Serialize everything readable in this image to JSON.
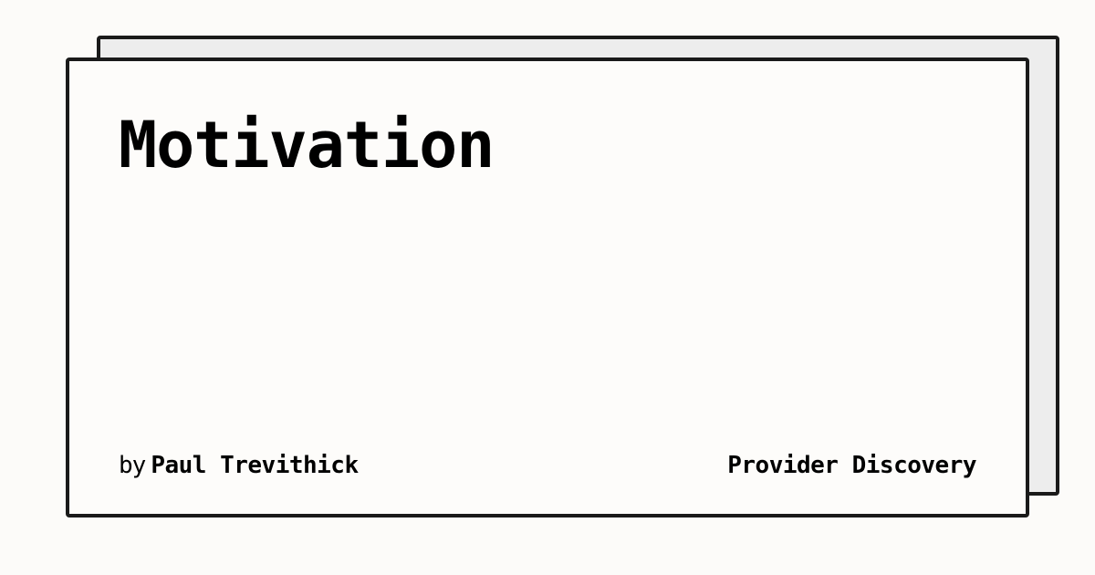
{
  "card": {
    "title": "Motivation",
    "byline_prefix": "by",
    "author": "Paul Trevithick",
    "site_name": "Provider Discovery"
  },
  "colors": {
    "background": "#fcfbf9",
    "card": "#fdfcfa",
    "shadow_card": "#ededed",
    "border": "#1a1a1a",
    "text": "#000000"
  }
}
